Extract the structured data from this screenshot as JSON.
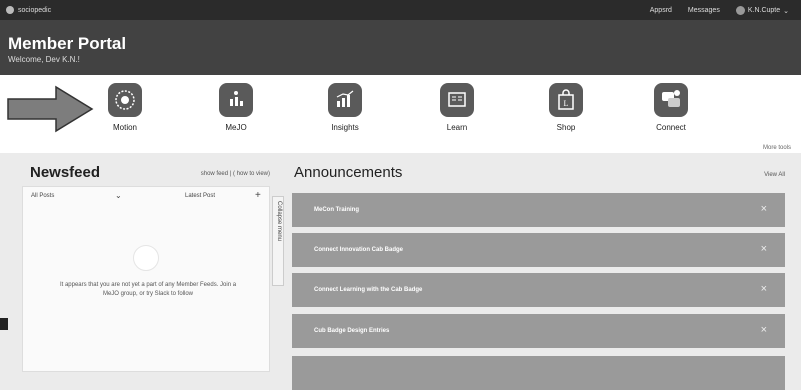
{
  "topbar": {
    "brand": "sociopedic",
    "links": [
      "Appsrd",
      "Messages"
    ],
    "user": "K.N.Cupte"
  },
  "header": {
    "title": "Member Portal",
    "welcome": "Welcome, Dev K.N.!"
  },
  "tiles": [
    {
      "label": "Motion",
      "icon": "motion-icon"
    },
    {
      "label": "MeJO",
      "icon": "chart-people-icon"
    },
    {
      "label": "Insights",
      "icon": "bar-chart-icon"
    },
    {
      "label": "Learn",
      "icon": "book-icon"
    },
    {
      "label": "Shop",
      "icon": "shopping-bag-icon"
    },
    {
      "label": "Connect",
      "icon": "chat-icon"
    }
  ],
  "more_label": "More tools",
  "newsfeed": {
    "title": "Newsfeed",
    "options": "show feed | ( how to view)",
    "filter": "All Posts",
    "sort": "Latest Post",
    "empty_message": "It appears that you are not yet a part of any Member Feeds. Join a MeJO group, or try Slack to follow"
  },
  "sidetab": "Collapse menu",
  "announcements": {
    "title": "Announcements",
    "view_all": "View All",
    "items": [
      "MeCon Training",
      "Connect Innovation Cab Badge",
      "Connect Learning with the Cab Badge",
      "Cub Badge Design Entries",
      ""
    ]
  },
  "colors": {
    "topbar": "#2b2b2b",
    "header": "#424242",
    "tile": "#5a5a5a",
    "announcement": "#9a9a9a"
  }
}
